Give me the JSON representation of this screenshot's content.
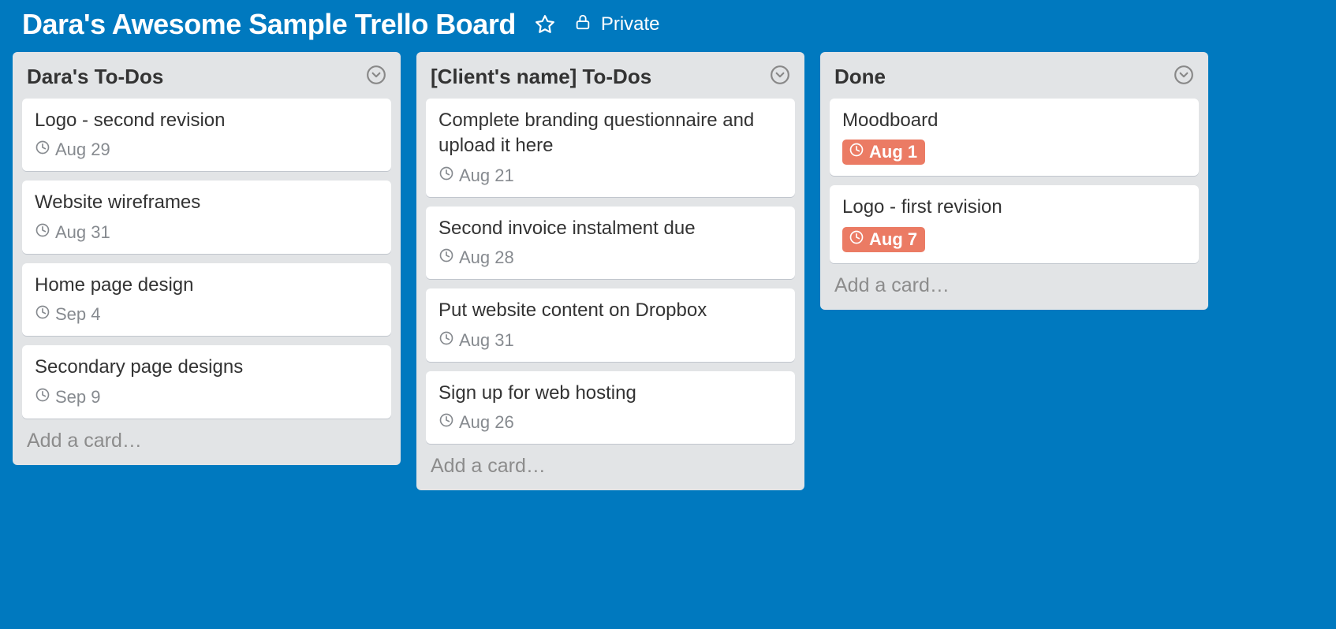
{
  "board": {
    "title": "Dara's Awesome Sample Trello Board",
    "privacy_label": "Private"
  },
  "lists": [
    {
      "title": "Dara's To-Dos",
      "add_card_label": "Add a card…",
      "cards": [
        {
          "title": "Logo - second revision",
          "due": "Aug 29",
          "done": false
        },
        {
          "title": "Website wireframes",
          "due": "Aug 31",
          "done": false
        },
        {
          "title": "Home page design",
          "due": "Sep 4",
          "done": false
        },
        {
          "title": "Secondary page designs",
          "due": "Sep 9",
          "done": false
        }
      ]
    },
    {
      "title": "[Client's name] To-Dos",
      "add_card_label": "Add a card…",
      "cards": [
        {
          "title": "Complete branding questionnaire and upload it here",
          "due": "Aug 21",
          "done": false
        },
        {
          "title": "Second invoice instalment due",
          "due": "Aug 28",
          "done": false
        },
        {
          "title": "Put website content on Dropbox",
          "due": "Aug 31",
          "done": false
        },
        {
          "title": "Sign up for web hosting",
          "due": "Aug 26",
          "done": false
        }
      ]
    },
    {
      "title": "Done",
      "add_card_label": "Add a card…",
      "cards": [
        {
          "title": "Moodboard",
          "due": "Aug 1",
          "done": true
        },
        {
          "title": "Logo - first revision",
          "due": "Aug 7",
          "done": true
        }
      ]
    }
  ]
}
